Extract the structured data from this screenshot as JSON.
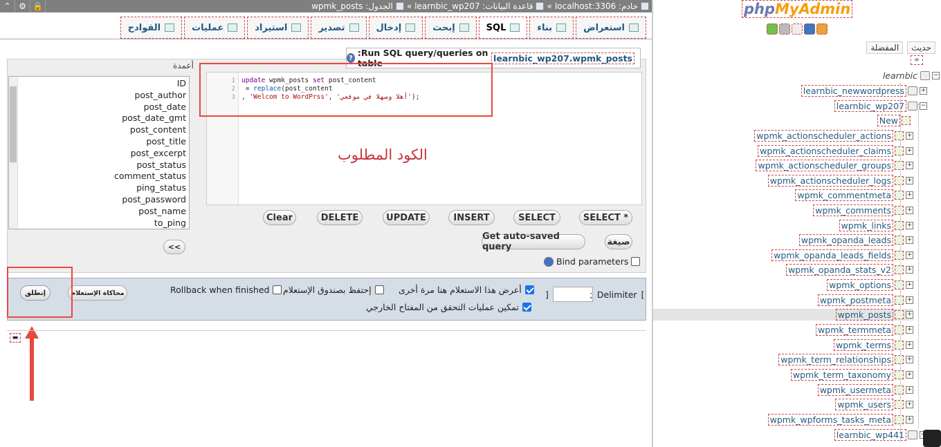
{
  "topbar": {
    "breadcrumb": [
      "خادم: localhost:3306",
      "»",
      "قاعدة البيانات: learnbic_wp207",
      "»",
      "الجدول: wpmk_posts"
    ]
  },
  "tabs": [
    {
      "label": "استعراض",
      "icon": "browse-icon",
      "active": false
    },
    {
      "label": "بناء",
      "icon": "structure-icon",
      "active": false
    },
    {
      "label": "SQL",
      "icon": "sql-icon",
      "active": true
    },
    {
      "label": "إبحث",
      "icon": "search-icon",
      "active": false
    },
    {
      "label": "إدخال",
      "icon": "insert-icon",
      "active": false
    },
    {
      "label": "تصدير",
      "icon": "export-icon",
      "active": false
    },
    {
      "label": "استيراد",
      "icon": "import-icon",
      "active": false
    },
    {
      "label": "عمليات",
      "icon": "wrench-icon",
      "active": false
    },
    {
      "label": "القوادح",
      "icon": "triggers-icon",
      "active": false
    }
  ],
  "run_query": {
    "label": ":Run SQL query/queries on table",
    "table": "learnbic_wp207.wpmk_posts"
  },
  "columns": {
    "title": "أعمدة",
    "items": [
      "ID",
      "post_author",
      "post_date",
      "post_date_gmt",
      "post_content",
      "post_title",
      "post_excerpt",
      "post_status",
      "comment_status",
      "ping_status",
      "post_password",
      "post_name",
      "to_ping"
    ]
  },
  "editor": {
    "line_numbers": [
      "1",
      "2",
      "3"
    ],
    "line1_kw1": "update",
    "line1_mid": " wpmk_posts ",
    "line1_kw2": "set",
    "line1_end": " post_content",
    "line2_start": " = ",
    "line2_fn": "replace",
    "line2_end": "(post_content",
    "line3_start": ", ",
    "line3_str1": "'Welcom to WordPrss'",
    "line3_mid": ", ",
    "line3_str2": "'أهلا وسهلا في موقعي'",
    "line3_end": ");"
  },
  "annotation": {
    "text": "الكود المطلوب",
    "color": "#e8483e"
  },
  "query_buttons": {
    "select_star": "SELECT *",
    "select": "SELECT",
    "insert": "INSERT",
    "update": "UPDATE",
    "delete": "DELETE",
    "clear": "Clear",
    "format": "صيغة",
    "get_auto_saved": "Get auto-saved query",
    "shift": "<<"
  },
  "bind_parameters": {
    "label": "Bind parameters",
    "checked": false
  },
  "options": {
    "delimiter_label": "Delimiter",
    "delimiter_open": "[",
    "delimiter_close": "]",
    "delimiter_value": ";",
    "show_again": {
      "label": "أعرض هذا الاستعلام هنا مرة أخرى",
      "checked": true
    },
    "retain_box": {
      "label": "إحتفظ بصندوق الإستعلام",
      "checked": false
    },
    "rollback": {
      "label": "Rollback when finished",
      "checked": false
    },
    "fk_checks": {
      "label": "تمكين عمليات التحقق من المفتاح الخارجي",
      "checked": true
    },
    "simulate": "محاكاة الإستعلام",
    "go": "إنطلق"
  },
  "nav": {
    "logo_php": "php",
    "logo_admin": "MyAdmin",
    "tabs": [
      "حديث",
      "المفضلة"
    ],
    "group": "learnbic",
    "databases": [
      "learnbic_newwordpress",
      "learnbic_wp207",
      "learnbic_wp441"
    ],
    "new_label": "New",
    "tables": [
      "wpmk_actionscheduler_actions",
      "wpmk_actionscheduler_claims",
      "wpmk_actionscheduler_groups",
      "wpmk_actionscheduler_logs",
      "wpmk_commentmeta",
      "wpmk_comments",
      "wpmk_links",
      "wpmk_opanda_leads",
      "wpmk_opanda_leads_fields",
      "wpmk_opanda_stats_v2",
      "wpmk_options",
      "wpmk_postmeta",
      "wpmk_posts",
      "wpmk_termmeta",
      "wpmk_terms",
      "wpmk_term_relationships",
      "wpmk_term_taxonomy",
      "wpmk_usermeta",
      "wpmk_users",
      "wpmk_wpforms_tasks_meta"
    ],
    "selected_table": "wpmk_posts"
  },
  "colors": {
    "accent": "#235a81",
    "annotation": "#e8483e",
    "footer_bg": "#d5dde6"
  }
}
